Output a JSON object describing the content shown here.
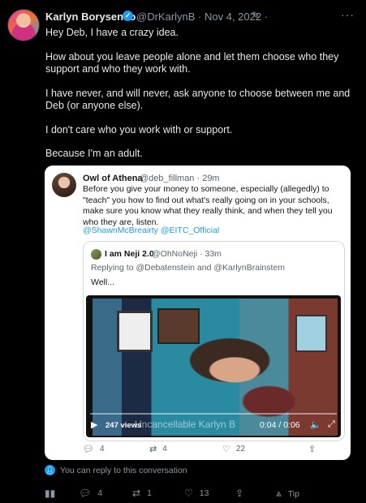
{
  "tweet": {
    "author_name": "Karlyn Borysenko",
    "handle_date": "@DrKarlynB · Nov 4, 2022 ·",
    "paragraphs": [
      "Hey Deb, I have a crazy idea.",
      "How about you leave people alone and let them choose who they support and who they work with.",
      "I have never, and will never, ask anyone to choose between me and Deb (or anyone else).",
      "I don't care who you work with or support.",
      "Because I'm an adult."
    ]
  },
  "quote": {
    "author_name": "Owl of Athena",
    "handle_time": "@deb_fillman · 29m",
    "text": "Before you give your money to someone, especially (allegedly) to \"teach\" you how to find out what's really going on in your schools, make sure you know what they really think, and when they tell you who they are, listen.",
    "links": "@ShawnMcBreairty @EITC_Official",
    "inner": {
      "author_name": "I am Neji 2.0",
      "handle_time": "@OhNoNeji · 33m",
      "replying_prefix": "Replying to",
      "replying_users": "@Debatenstein and @KarlynBrainstem",
      "text": "Well...",
      "video": {
        "views": "247 views",
        "caption": "Uncancellable Karlyn B",
        "time": "0:04 / 0:06",
        "progress": 0.0
      }
    },
    "actions": {
      "replies": "4",
      "retweets": "4",
      "likes": "22"
    }
  },
  "reply_note": "You can reply to this conversation",
  "actions": {
    "replies": "4",
    "retweets": "1",
    "likes": "13",
    "tip": "Tip"
  }
}
